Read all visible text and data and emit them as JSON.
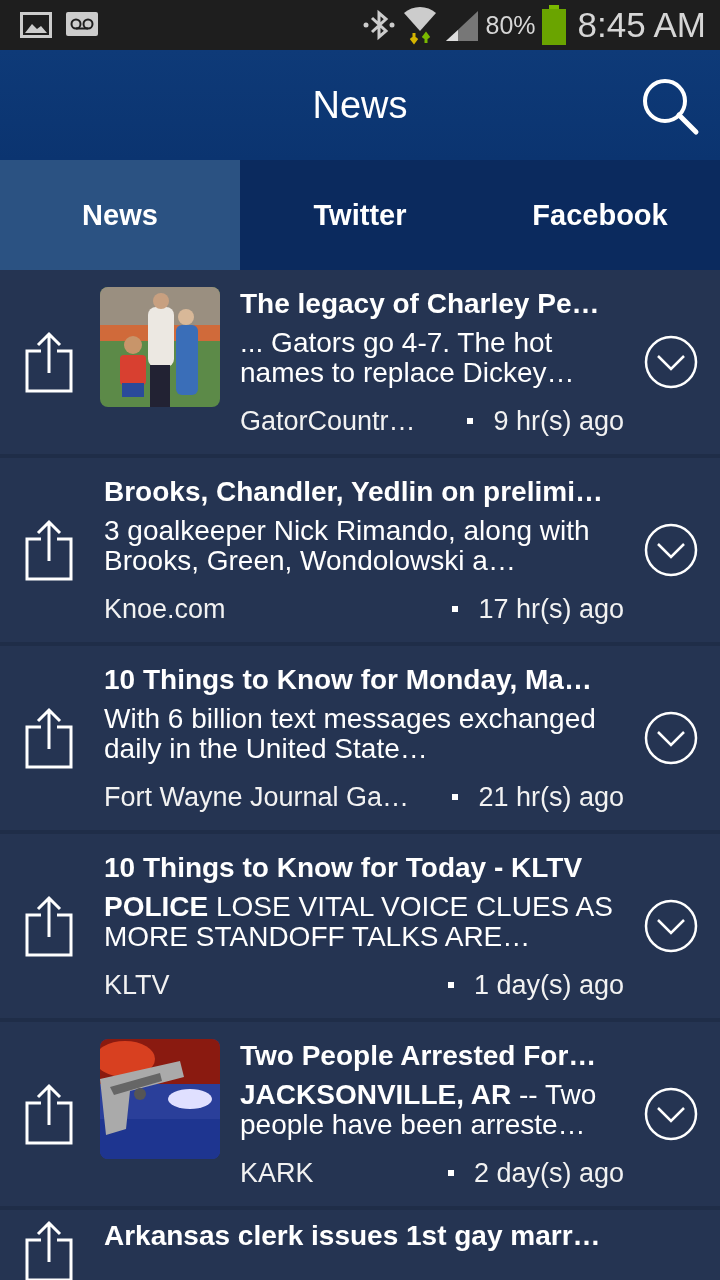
{
  "status_bar": {
    "battery_text": "80%",
    "time": "8:45 AM"
  },
  "header": {
    "title": "News"
  },
  "tabs": [
    {
      "label": "News",
      "selected": true
    },
    {
      "label": "Twitter",
      "selected": false
    },
    {
      "label": "Facebook",
      "selected": false
    }
  ],
  "articles": [
    {
      "title": "The legacy of Charley Pe…",
      "snippet": "... Gators go 4-7. The hot names to replace Dickey…",
      "source": "GatorCountr…",
      "time": "9 hr(s) ago"
    },
    {
      "title": "Brooks, Chandler, Yedlin on prelimi…",
      "snippet": "3 goalkeeper Nick Rimando, along with Brooks, Green, Wondolowski a…",
      "source": "Knoe.com",
      "time": "17 hr(s) ago"
    },
    {
      "title": "10 Things to Know for Monday, Ma…",
      "snippet": "With 6 billion text messages exchanged daily in the United State…",
      "source": "Fort Wayne Journal Ga…",
      "time": "21 hr(s) ago"
    },
    {
      "title": "10 Things to Know for Today - KLTV",
      "snippet": "**POLICE** LOSE VITAL VOICE CLUES AS MORE STANDOFF TALKS ARE…",
      "source": "KLTV",
      "time": "1 day(s) ago"
    },
    {
      "title": "Two People Arrested For…",
      "snippet": "**JACKSONVILLE, AR** -- Two people have been arreste…",
      "source": "KARK",
      "time": "2 day(s) ago"
    },
    {
      "title": "Arkansas clerk issues 1st gay marr…"
    }
  ]
}
